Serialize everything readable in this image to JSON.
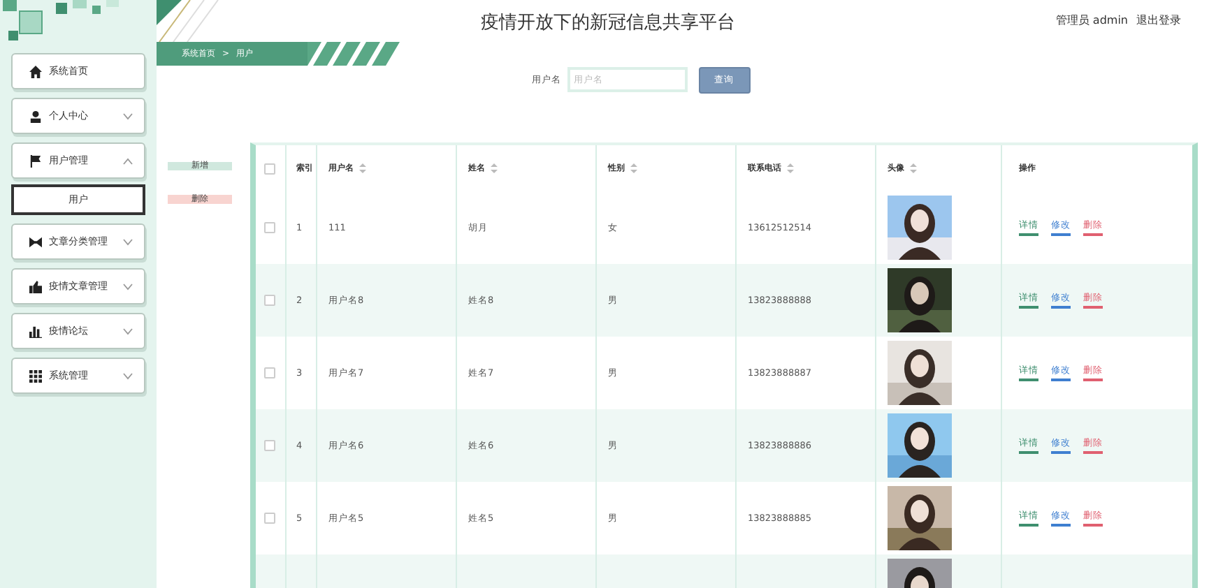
{
  "header": {
    "title": "疫情开放下的新冠信息共享平台",
    "user": "管理员 admin",
    "logout": "退出登录"
  },
  "breadcrumb": {
    "home": "系统首页",
    "separator": ">",
    "current": "用户"
  },
  "sidebar": {
    "items": [
      {
        "label": "系统首页",
        "kind": "link"
      },
      {
        "label": "个人中心",
        "kind": "group",
        "expanded": false
      },
      {
        "label": "用户管理",
        "kind": "group",
        "expanded": true,
        "children": [
          {
            "label": "用户",
            "selected": true
          }
        ]
      },
      {
        "label": "文章分类管理",
        "kind": "group",
        "expanded": false
      },
      {
        "label": "疫情文章管理",
        "kind": "group",
        "expanded": false
      },
      {
        "label": "疫情论坛",
        "kind": "group",
        "expanded": false
      },
      {
        "label": "系统管理",
        "kind": "group",
        "expanded": false
      }
    ]
  },
  "search": {
    "label": "用户名",
    "placeholder": "用户名",
    "button": "查询"
  },
  "actions": {
    "add": "新增",
    "delete": "删除"
  },
  "table": {
    "select_all": {
      "checked": false
    },
    "columns": [
      {
        "label": "索引",
        "sortable": false
      },
      {
        "label": "用户名",
        "sortable": true
      },
      {
        "label": "姓名",
        "sortable": true
      },
      {
        "label": "性别",
        "sortable": true
      },
      {
        "label": "联系电话",
        "sortable": true
      },
      {
        "label": "头像",
        "sortable": true
      },
      {
        "label": "操作",
        "sortable": false
      }
    ],
    "rows": [
      {
        "index": "1",
        "username": "111",
        "name": "胡月",
        "gender": "女",
        "phone": "13612512514",
        "checked": false,
        "actions": [
          {
            "label": "详情",
            "color": "#3f8f6f"
          },
          {
            "label": "修改",
            "color": "#3f7fd0"
          },
          {
            "label": "删除",
            "color": "#e06070"
          }
        ]
      },
      {
        "index": "2",
        "username": "用户名8",
        "name": "姓名8",
        "gender": "男",
        "phone": "13823888888",
        "checked": false,
        "actions": [
          {
            "label": "详情",
            "color": "#3f8f6f"
          },
          {
            "label": "修改",
            "color": "#3f7fd0"
          },
          {
            "label": "删除",
            "color": "#e06070"
          }
        ]
      },
      {
        "index": "3",
        "username": "用户名7",
        "name": "姓名7",
        "gender": "男",
        "phone": "13823888887",
        "checked": false,
        "actions": [
          {
            "label": "详情",
            "color": "#3f8f6f"
          },
          {
            "label": "修改",
            "color": "#3f7fd0"
          },
          {
            "label": "删除",
            "color": "#e06070"
          }
        ]
      },
      {
        "index": "4",
        "username": "用户名6",
        "name": "姓名6",
        "gender": "男",
        "phone": "13823888886",
        "checked": false,
        "actions": [
          {
            "label": "详情",
            "color": "#3f8f6f"
          },
          {
            "label": "修改",
            "color": "#3f7fd0"
          },
          {
            "label": "删除",
            "color": "#e06070"
          }
        ]
      },
      {
        "index": "5",
        "username": "用户名5",
        "name": "姓名5",
        "gender": "男",
        "phone": "13823888885",
        "checked": false,
        "actions": [
          {
            "label": "详情",
            "color": "#3f8f6f"
          },
          {
            "label": "修改",
            "color": "#3f7fd0"
          },
          {
            "label": "删除",
            "color": "#e06070"
          }
        ]
      }
    ]
  }
}
